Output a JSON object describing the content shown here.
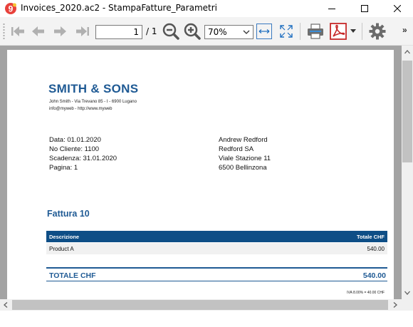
{
  "window": {
    "title": "Invoices_2020.ac2 - StampaFatture_Parametri",
    "app_icon": "banana-9-icon"
  },
  "toolbar": {
    "page_value": "1",
    "page_total": "/ 1",
    "zoom_value": "70%",
    "overflow_label": "»",
    "icons": [
      "first-page-icon",
      "prev-page-icon",
      "next-page-icon",
      "last-page-icon",
      "zoom-out-icon",
      "zoom-in-icon",
      "fit-width-icon",
      "fit-page-icon",
      "print-icon",
      "pdf-icon",
      "settings-icon"
    ]
  },
  "invoice": {
    "company": "SMITH & SONS",
    "address_line1": "John  Smith - Via Trevano 85 - I - 6900 Lugano",
    "address_line2": "info@myweb - http://www.myweb",
    "meta": [
      "Data: 01.01.2020",
      "No Cliente: 1100",
      "Scadenza: 31.01.2020",
      "Pagina: 1"
    ],
    "customer": [
      "Andrew Redford",
      "Redford SA",
      "Viale Stazione 11",
      "6500 Bellinzona"
    ],
    "title": "Fattura 10",
    "table": {
      "headers": [
        "Descrizione",
        "Totale CHF"
      ],
      "rows": [
        [
          "Product A",
          "540.00"
        ]
      ]
    },
    "total_label": "TOTALE CHF",
    "total_value": "540.00",
    "vat_note": "IVA 8.00% = 40.00 CHF"
  },
  "colors": {
    "accent": "#1f5a94",
    "table_header": "#0e4e86",
    "toolbar_bg": "#f3f3f3",
    "viewport_bg": "#a3a3a3"
  }
}
